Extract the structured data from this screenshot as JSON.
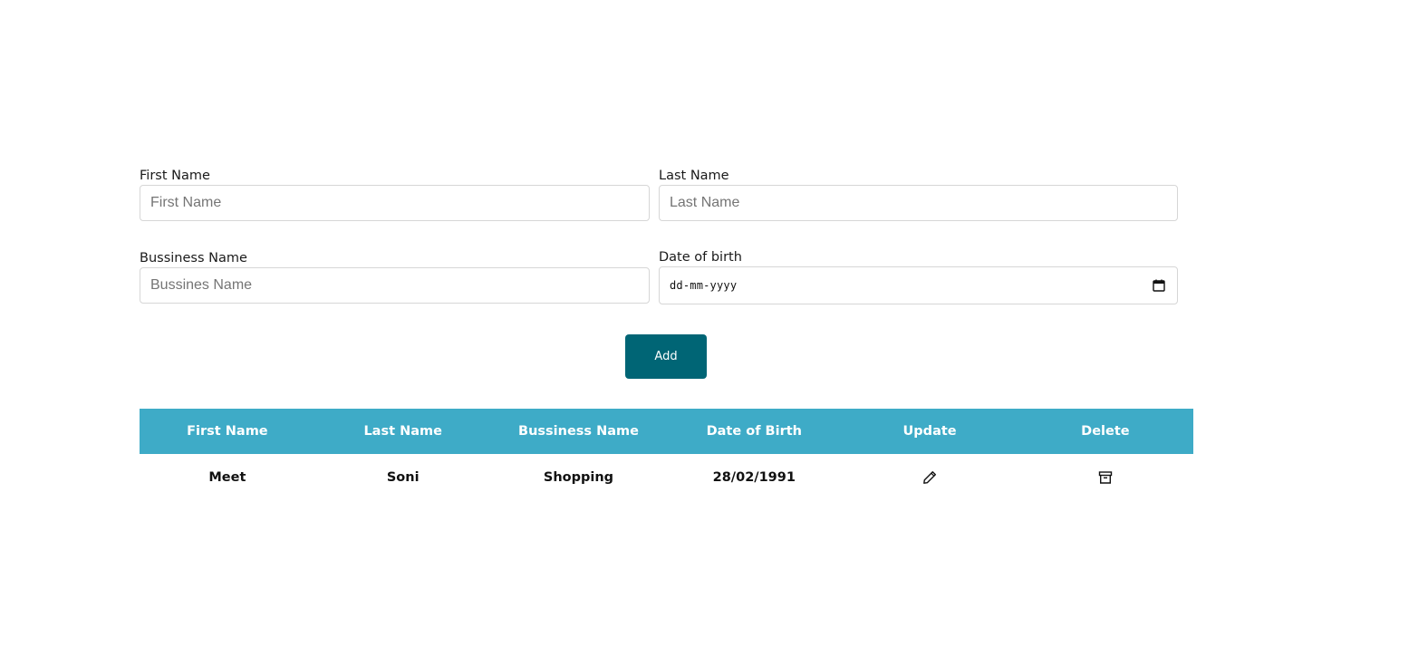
{
  "form": {
    "first_name": {
      "label": "First Name",
      "placeholder": "First Name",
      "value": ""
    },
    "last_name": {
      "label": "Last Name",
      "placeholder": "Last Name",
      "value": ""
    },
    "business_name": {
      "label": "Bussiness Name",
      "placeholder": "Bussines Name",
      "value": ""
    },
    "date_of_birth": {
      "label": "Date of birth",
      "placeholder": "dd-mm-yyyy",
      "icon": "calendar-icon"
    },
    "add_label": "Add"
  },
  "table": {
    "headers": [
      "First Name",
      "Last Name",
      "Bussiness Name",
      "Date of Birth",
      "Update",
      "Delete"
    ],
    "rows": [
      {
        "first_name": "Meet",
        "last_name": "Soni",
        "business_name": "Shopping",
        "date_of_birth": "28/02/1991",
        "update_icon": "pencil-icon",
        "delete_icon": "archive-icon"
      }
    ]
  },
  "colors": {
    "button_bg": "#006575",
    "header_bg": "#3eabc7",
    "header_text": "#ffffff"
  }
}
